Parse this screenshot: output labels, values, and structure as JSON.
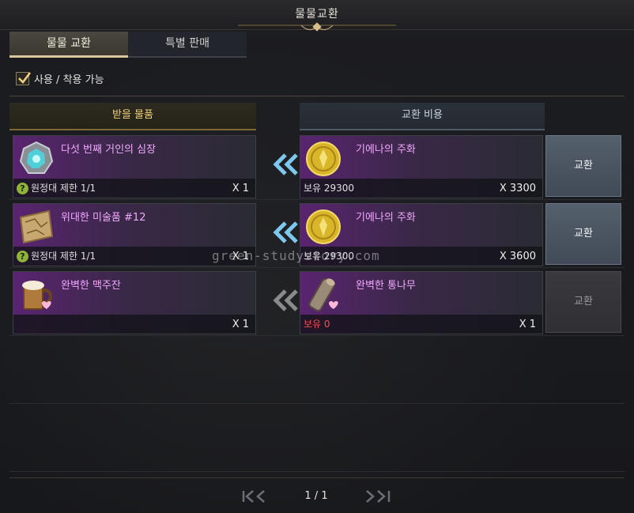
{
  "window": {
    "title": "물물교환"
  },
  "tabs": [
    {
      "label": "물물 교환",
      "active": true
    },
    {
      "label": "특별 판매",
      "active": false
    }
  ],
  "filter": {
    "label": "사용 / 착용 가능",
    "checked": true
  },
  "columns": {
    "receive": "받을 물품",
    "cost": "교환 비용"
  },
  "rows": [
    {
      "reward": {
        "name": "다섯 번째 거인의 심장",
        "limit": "원정대 제한 1/1",
        "qty": "X 1",
        "icon": "gem-heart-icon"
      },
      "cost": {
        "name": "기에나의 주화",
        "owned": "보유 29300",
        "qty": "X 3300",
        "icon": "gold-coin-icon"
      },
      "button": "교환",
      "enabled": true
    },
    {
      "reward": {
        "name": "위대한 미술품 #12",
        "limit": "원정대 제한 1/1",
        "qty": "X 1",
        "icon": "painting-map-icon"
      },
      "cost": {
        "name": "기에나의 주화",
        "owned": "보유 29300",
        "qty": "X 3600",
        "icon": "gold-coin-icon"
      },
      "button": "교환",
      "enabled": true
    },
    {
      "reward": {
        "name": "완벽한 맥주잔",
        "limit": "",
        "qty": "X 1",
        "icon": "beer-mug-icon"
      },
      "cost": {
        "name": "완벽한 통나무",
        "owned": "보유 0",
        "qty": "X 1",
        "icon": "log-icon"
      },
      "button": "교환",
      "enabled": false
    }
  ],
  "watermark": "green-studystory.com",
  "pagination": {
    "text": "1 / 1"
  },
  "colors": {
    "accent_gold": "#f0d27a",
    "item_name": "#f2a8ff",
    "owned_zero": "#ff4a4a",
    "arrow_active": "#7ec8f0",
    "arrow_inactive": "#8a8a8a"
  }
}
